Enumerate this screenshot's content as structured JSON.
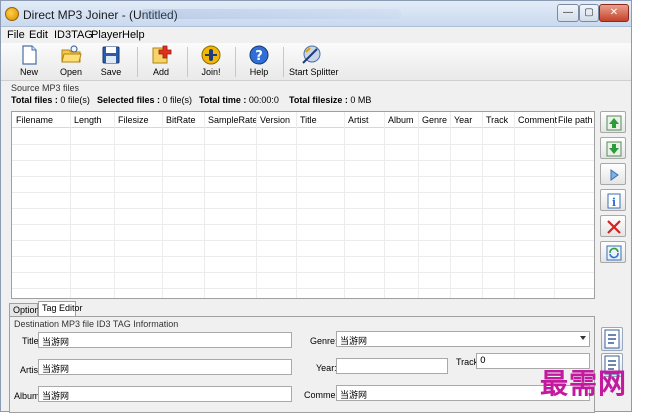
{
  "window": {
    "title": "Direct MP3 Joiner - (Untitled)"
  },
  "menu": [
    {
      "label": "File"
    },
    {
      "label": "Edit"
    },
    {
      "label": "ID3TAG"
    },
    {
      "label": "Player"
    },
    {
      "label": "Help"
    }
  ],
  "toolbar": [
    {
      "label": "New",
      "icon": "new-file-icon"
    },
    {
      "label": "Open",
      "icon": "open-folder-icon"
    },
    {
      "label": "Save",
      "icon": "save-disk-icon"
    },
    {
      "label": "Add",
      "icon": "add-file-icon"
    },
    {
      "label": "Join!",
      "icon": "join-icon"
    },
    {
      "label": "Help",
      "icon": "help-icon"
    },
    {
      "label": "Start Splitter",
      "icon": "splitter-icon"
    }
  ],
  "source": {
    "label": "Source MP3 files",
    "total_files_label": "Total files :",
    "total_files_value": "0 file(s)",
    "selected_files_label": "Selected files :",
    "selected_files_value": "0 file(s)",
    "total_time_label": "Total time :",
    "total_time_value": "00:00:0",
    "total_filesize_label": "Total filesize :",
    "total_filesize_value": "0 MB"
  },
  "grid": {
    "columns": [
      "Filename",
      "Length",
      "Filesize",
      "BitRate",
      "SampleRate",
      "Version",
      "Title",
      "Artist",
      "Album",
      "Genre",
      "Year",
      "Track",
      "Comment",
      "File path"
    ]
  },
  "side_buttons": [
    "move-up-icon",
    "move-down-icon",
    "play-icon",
    "info-icon",
    "remove-icon",
    "refresh-icon"
  ],
  "tabs": [
    {
      "label": "Options"
    },
    {
      "label": "Tag Editor"
    }
  ],
  "tag_editor": {
    "dest_label": "Destination MP3 file ID3 TAG Information",
    "title_label": "Title:",
    "title_value": "当游网",
    "artist_label": "Artist:",
    "artist_value": "当游网",
    "album_label": "Album:",
    "album_value": "当游网",
    "genre_label": "Genre:",
    "genre_value": "当游网",
    "year_label": "Year:",
    "year_value": "",
    "track_label": "Track:",
    "track_value": "0",
    "comment_label": "Comment:",
    "comment_value": "当游网"
  },
  "watermark": "最需网",
  "colors": {
    "accent_close": "#c6422a",
    "watermark": "#c21a9f",
    "green": "#2e9b3a",
    "red": "#d42020"
  }
}
